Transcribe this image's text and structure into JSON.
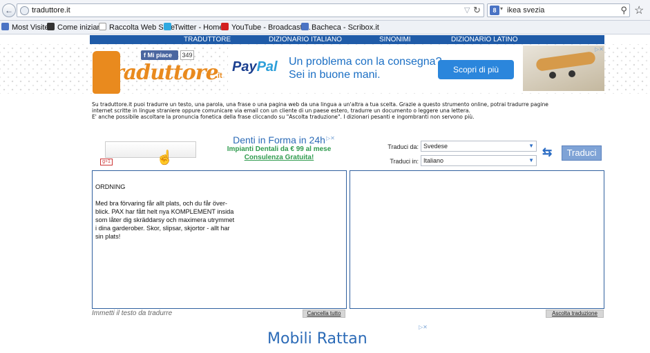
{
  "browser": {
    "url": "traduttore.it",
    "search_value": "ikea svezia",
    "search_engine": "8"
  },
  "bookmarks": [
    {
      "label": "Most Visited",
      "icon": "most-visited-icon",
      "color": "#4a73c4"
    },
    {
      "label": "Come iniziare",
      "icon": "m-icon",
      "color": "#333333"
    },
    {
      "label": "Raccolta Web Slice",
      "icon": "web-slice-icon",
      "color": "#cfd8e6"
    },
    {
      "label": "Twitter - Home",
      "icon": "twitter-icon",
      "color": "#2fa9e0"
    },
    {
      "label": "YouTube - Broadcast ...",
      "icon": "youtube-icon",
      "color": "#d32020"
    },
    {
      "label": "Bacheca - Scribox.it",
      "icon": "pen-icon",
      "color": "#4a73c4"
    }
  ],
  "site_nav": [
    "TRADUTTORE",
    "DIZIONARIO ITALIANO",
    "SINONIMI",
    "DIZIONARIO LATINO"
  ],
  "facebook": {
    "label": "Mi piace",
    "count": "349"
  },
  "logo": {
    "text": "raduttore",
    "suffix": ".it"
  },
  "paypal_ad": {
    "logo_main": "Pay",
    "logo_accent": "Pal",
    "line1": "Un problema con la consegna?",
    "line2": "Sei in buone mani.",
    "button": "Scopri di più"
  },
  "description": {
    "line1": "Su traduttore.it puoi tradurre un testo, una parola, una frase o una pagina web da una lingua a un'altra a tua scelta. Grazie a questo strumento online, potrai tradurre pagine",
    "line2": "internet scritte in lingue straniere oppure comunicare via email con un cliente di un paese estero, tradurre un documento o leggere una lettera.",
    "line3": "E' anche possibile ascoltare la pronuncia fonetica della frase cliccando su \"Ascolta traduzione\". I dizionari pesanti e ingombranti non servono più."
  },
  "gplus_label": "g+1",
  "denti_ad": {
    "title": "Denti in Forma in 24h",
    "line": "Impianti Dentali da € 99 al mese",
    "link": "Consulenza Gratuita!"
  },
  "translator": {
    "from_label": "Traduci da:",
    "from_value": "Svedese",
    "to_label": "Traduci in:",
    "to_value": "Italiano",
    "button": "Traduci",
    "source_lines": [
      "ORDNING",
      "",
      "Med bra förvaring får allt plats, och du får över-",
      "blick. PAX har fått helt nya KOMPLEMENT insida",
      "som låter dig skräddarsy och maximera utrymmet",
      "i dina garderober. Skor, slipsar, skjortor - allt har",
      "sin plats!"
    ],
    "hint": "Immetti il testo da tradurre",
    "clear_button": "Cancella tutto",
    "listen_button": "Ascolta traduzione"
  },
  "bottom_ad": {
    "title": "Mobili Rattan"
  }
}
